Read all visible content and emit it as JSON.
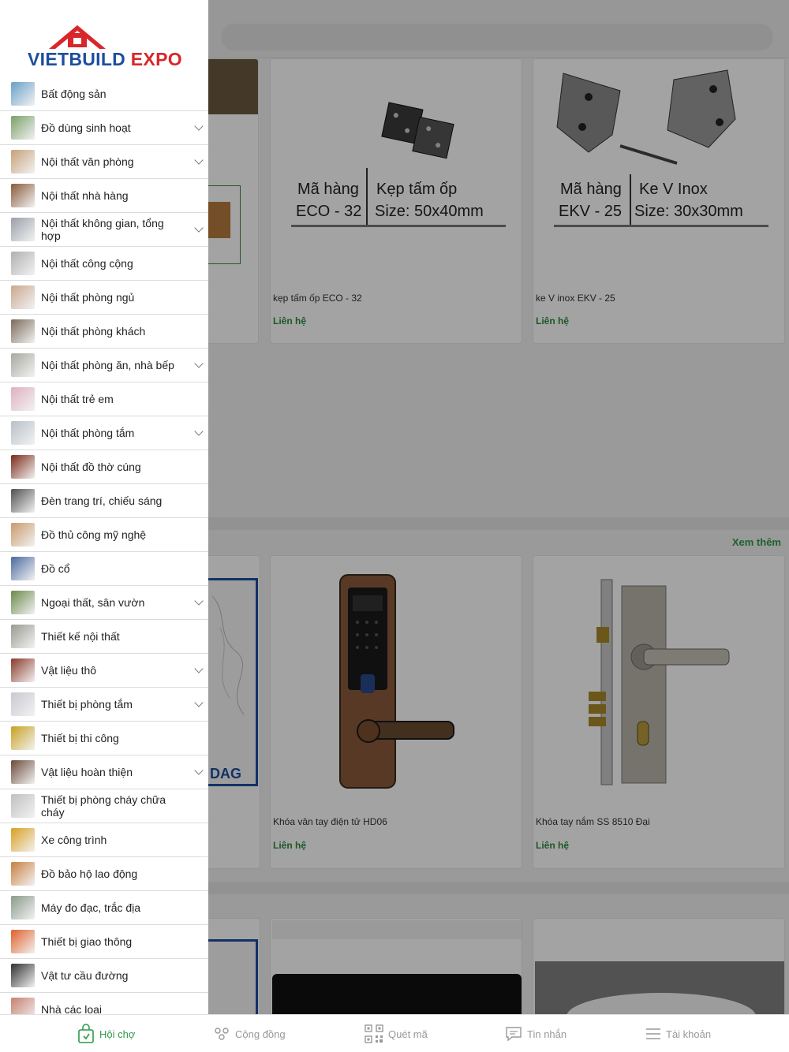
{
  "brand": {
    "logo_part1": "VIETBUILD",
    "logo_part2": " EXPO"
  },
  "categories": [
    {
      "label": "Bất động sản",
      "expandable": false
    },
    {
      "label": "Đồ dùng sinh hoạt",
      "expandable": true
    },
    {
      "label": "Nội thất văn phòng",
      "expandable": true
    },
    {
      "label": "Nội thất nhà hàng",
      "expandable": false
    },
    {
      "label": "Nội thất không gian, tổng hợp",
      "expandable": true
    },
    {
      "label": "Nội thất công cộng",
      "expandable": false
    },
    {
      "label": "Nội thất phòng ngủ",
      "expandable": false
    },
    {
      "label": "Nội thất phòng khách",
      "expandable": false
    },
    {
      "label": "Nội thất phòng ăn, nhà bếp",
      "expandable": true
    },
    {
      "label": "Nội thất trẻ em",
      "expandable": false
    },
    {
      "label": "Nội thất phòng tắm",
      "expandable": true
    },
    {
      "label": "Nội thất đồ thờ cúng",
      "expandable": false
    },
    {
      "label": "Đèn trang trí, chiếu sáng",
      "expandable": false
    },
    {
      "label": "Đồ thủ công mỹ nghệ",
      "expandable": false
    },
    {
      "label": "Đồ cổ",
      "expandable": false
    },
    {
      "label": "Ngoại thất, sân vườn",
      "expandable": true
    },
    {
      "label": "Thiết kế nội thất",
      "expandable": false
    },
    {
      "label": "Vật liệu thô",
      "expandable": true
    },
    {
      "label": "Thiết bị phòng tắm",
      "expandable": true
    },
    {
      "label": "Thiết bị thi công",
      "expandable": false
    },
    {
      "label": "Vật liệu hoàn thiện",
      "expandable": true
    },
    {
      "label": "Thiết bị phòng cháy chữa cháy",
      "expandable": false
    },
    {
      "label": "Xe công trình",
      "expandable": false
    },
    {
      "label": "Đồ bảo hộ lao động",
      "expandable": false
    },
    {
      "label": "Máy đo đạc, trắc địa",
      "expandable": false
    },
    {
      "label": "Thiết bị giao thông",
      "expandable": false
    },
    {
      "label": "Vật tư cầu đường",
      "expandable": false
    },
    {
      "label": "Nhà các loại",
      "expandable": false
    }
  ],
  "products": {
    "p1": {
      "title": "kẹp tấm ốp ECO - 32",
      "price": "Liên hệ",
      "spec_left_top": "Mã hàng",
      "spec_left_bottom": "ECO - 32",
      "spec_right_top": "Kẹp tấm ốp",
      "spec_right_bottom": "Size: 50x40mm"
    },
    "p2": {
      "title": "ke V inox EKV - 25",
      "price": "Liên hệ",
      "spec_left_top": "Mã hàng",
      "spec_left_bottom": "EKV - 25",
      "spec_right_top": "Ke V Inox",
      "spec_right_bottom": "Size: 30x30mm"
    },
    "p3": {
      "title": "Khóa vân tay điện tử HD06",
      "price": "Liên hệ"
    },
    "p4": {
      "title": "Khóa tay nắm SS 8510 Đại",
      "price": "Liên hệ"
    },
    "partial_brand": "DAG"
  },
  "section": {
    "see_more": "Xem thêm"
  },
  "tabbar": {
    "tabs": [
      {
        "label": "Hội chợ",
        "icon": "fair-bag-icon",
        "active": true
      },
      {
        "label": "Cộng đồng",
        "icon": "community-icon",
        "active": false
      },
      {
        "label": "Quét mã",
        "icon": "qr-code-icon",
        "active": false
      },
      {
        "label": "Tin nhắn",
        "icon": "message-icon",
        "active": false
      },
      {
        "label": "Tài khoản",
        "icon": "menu-lines-icon",
        "active": false
      }
    ]
  },
  "colors": {
    "accent": "#2e9a4a",
    "brand_blue": "#1d4e9e",
    "brand_red": "#d9262a"
  }
}
